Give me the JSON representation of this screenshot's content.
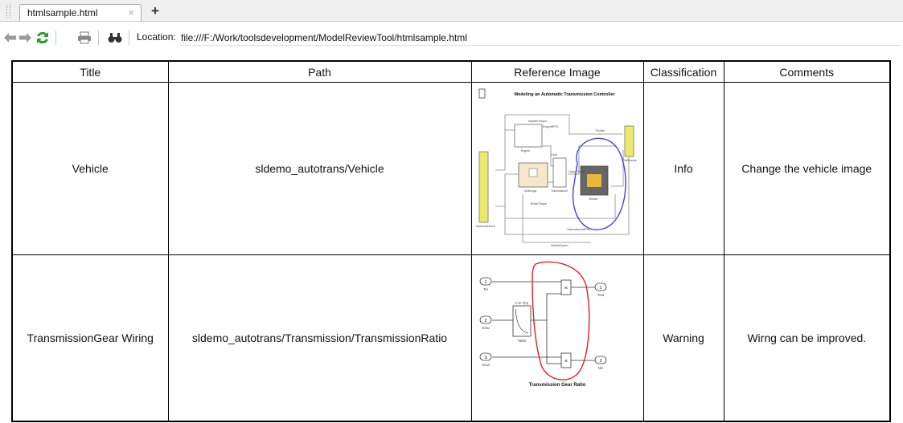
{
  "tab": {
    "title": "htmlsample.html",
    "close_glyph": "×",
    "new_tab_glyph": "+"
  },
  "toolbar": {
    "location_label": "Location:",
    "location_value": "file:///F:/Work/toolsdevelopment/ModelReviewTool/htmlsample.html",
    "icons": [
      "back-arrow-icon",
      "forward-arrow-icon",
      "refresh-icon",
      "print-icon",
      "find-icon"
    ]
  },
  "table": {
    "headers": [
      "Title",
      "Path",
      "Reference Image",
      "Classification",
      "Comments"
    ],
    "rows": [
      {
        "title": "Vehicle",
        "path": "sldemo_autotrans/Vehicle",
        "classification": "Info",
        "comment": "Change the vehicle image",
        "image": {
          "title": "Modeling an Automatic Transmission Controller",
          "block_labels": [
            "ImpellerTorque",
            "Throttle",
            "EngineRPM",
            "Engine",
            "Gear",
            "ShiftLogic",
            "Transmission",
            "OutputTorque",
            "Vehicle",
            "VehicleSpeed",
            "TransmissionRPM",
            "BrakeTorque",
            "ManeuversGUI",
            "PlotResults"
          ],
          "highlight_color": "#4444dd"
        }
      },
      {
        "title": "TransmissionGear Wiring",
        "path": "sldemo_autotrans/Transmission/TransmissionRatio",
        "classification": "Warning",
        "comment": "Wirng can be improved.",
        "image": {
          "title": "Transmission Gear Ratio",
          "port_labels": [
            "Tin",
            "Gear",
            "Nout",
            "Tout",
            "Nin"
          ],
          "port_numbers": [
            "1",
            "2",
            "3",
            "1",
            "2"
          ],
          "lookup_label": "1-D T(u)",
          "table_label": "Table",
          "product_glyph": "×",
          "highlight_color": "#dd2222"
        }
      }
    ]
  }
}
